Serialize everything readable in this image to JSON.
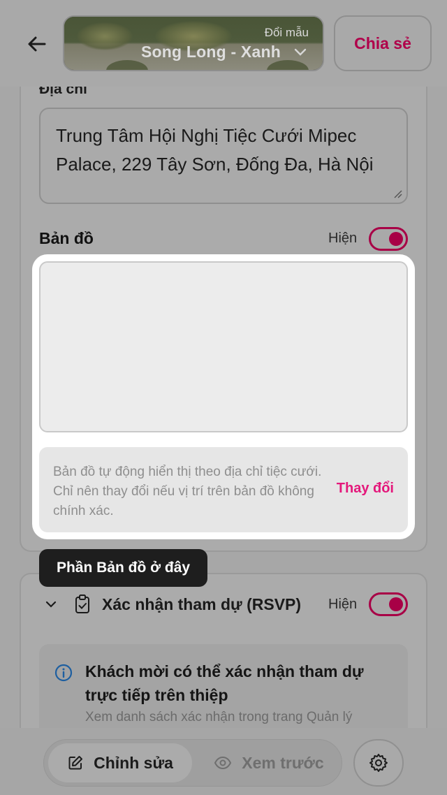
{
  "header": {
    "back_icon": "arrow-left-icon",
    "template_label": "Đổi mẫu",
    "template_name": "Song Long - Xanh",
    "share_label": "Chia sẻ"
  },
  "address": {
    "label": "Địa chỉ",
    "value": "Trung Tâm Hội Nghị Tiệc Cưới Mipec Palace, 229 Tây Sơn, Đống Đa, Hà Nội"
  },
  "map": {
    "label": "Bản đồ",
    "show_label": "Hiện",
    "toggle_on": true,
    "note": "Bản đồ tự động hiển thị theo địa chỉ tiệc cưới. Chỉ nên thay đổi nếu vị trí trên bản đồ không chính xác.",
    "change_label": "Thay đổi"
  },
  "tooltip": {
    "text": "Phần Bản đồ ở đây"
  },
  "rsvp": {
    "title": "Xác nhận tham dự (RSVP)",
    "show_label": "Hiện",
    "toggle_on": true,
    "info_title": "Khách mời có thể xác nhận tham dự trực tiếp trên thiệp",
    "info_sub": "Xem danh sách xác nhận trong trang Quản lý"
  },
  "bottom_bar": {
    "edit_label": "Chỉnh sửa",
    "preview_label": "Xem trước"
  },
  "colors": {
    "accent": "#e4187b",
    "overlay_gray": "#a9a9a9",
    "tooltip_bg": "#1e1e1e"
  }
}
